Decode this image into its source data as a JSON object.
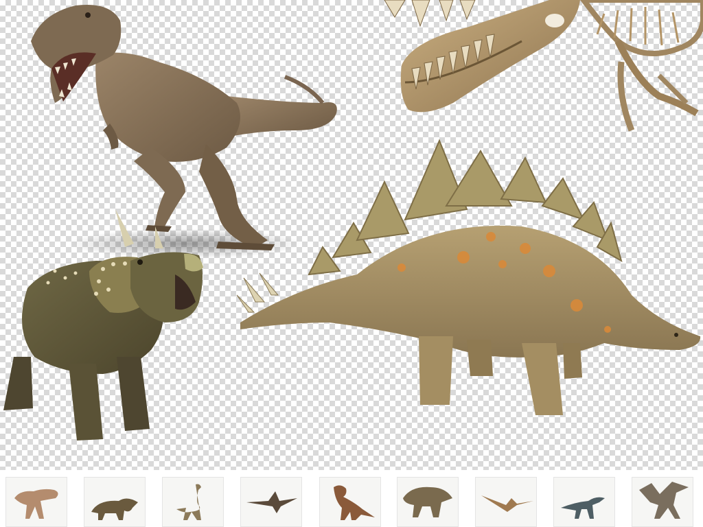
{
  "scene": {
    "main_figures": [
      {
        "name": "tyrannosaurus",
        "color": "#8a7257"
      },
      {
        "name": "triceratops",
        "color": "#5f5636"
      },
      {
        "name": "stegosaurus",
        "color": "#a08a5c"
      },
      {
        "name": "dinosaur-skeleton-skull",
        "color": "#b59a6d"
      }
    ],
    "background": "transparency-checkerboard"
  },
  "thumbnails": [
    {
      "subject": "t-rex-roaring",
      "color": "#b48c6e"
    },
    {
      "subject": "triceratops",
      "color": "#6a5a3e"
    },
    {
      "subject": "ostrich-dinosaur",
      "color": "#8c7a5a"
    },
    {
      "subject": "pterosaur-flying",
      "color": "#5a4a3a"
    },
    {
      "subject": "t-rex-standing",
      "color": "#8a5a3a"
    },
    {
      "subject": "t-rex-closeup",
      "color": "#7a6a4e"
    },
    {
      "subject": "pteranodon",
      "color": "#a07a50"
    },
    {
      "subject": "raptor",
      "color": "#4e5e64"
    },
    {
      "subject": "dragon-pair",
      "color": "#7a6e5e"
    }
  ]
}
